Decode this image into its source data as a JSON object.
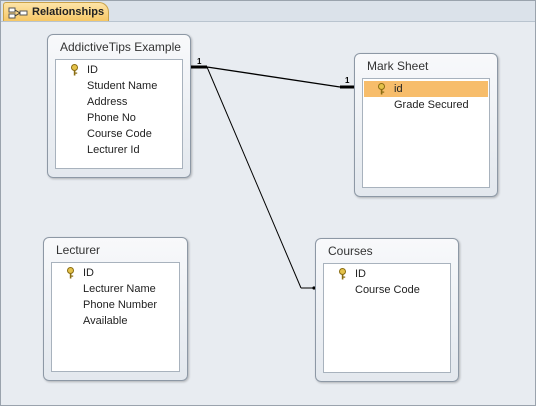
{
  "tab": {
    "label": "Relationships",
    "icon": "relationships-icon"
  },
  "tables": {
    "addictive": {
      "title": "AddictiveTips Example",
      "fields": [
        "ID",
        "Student Name",
        "Address",
        "Phone No",
        "Course Code",
        "Lecturer Id"
      ]
    },
    "marksheet": {
      "title": "Mark Sheet",
      "fields": [
        "id",
        "Grade Secured"
      ]
    },
    "lecturer": {
      "title": "Lecturer",
      "fields": [
        "ID",
        "Lecturer Name",
        "Phone Number",
        "Available"
      ]
    },
    "courses": {
      "title": "Courses",
      "fields": [
        "ID",
        "Course Code"
      ]
    }
  },
  "relationships": {
    "addictive_marksheet": {
      "from_card": "1",
      "to_card": "1"
    }
  },
  "colors": {
    "selected_field": "#f7bd6b",
    "key_icon": "#c9a020",
    "tab_active": "#f6c765"
  }
}
